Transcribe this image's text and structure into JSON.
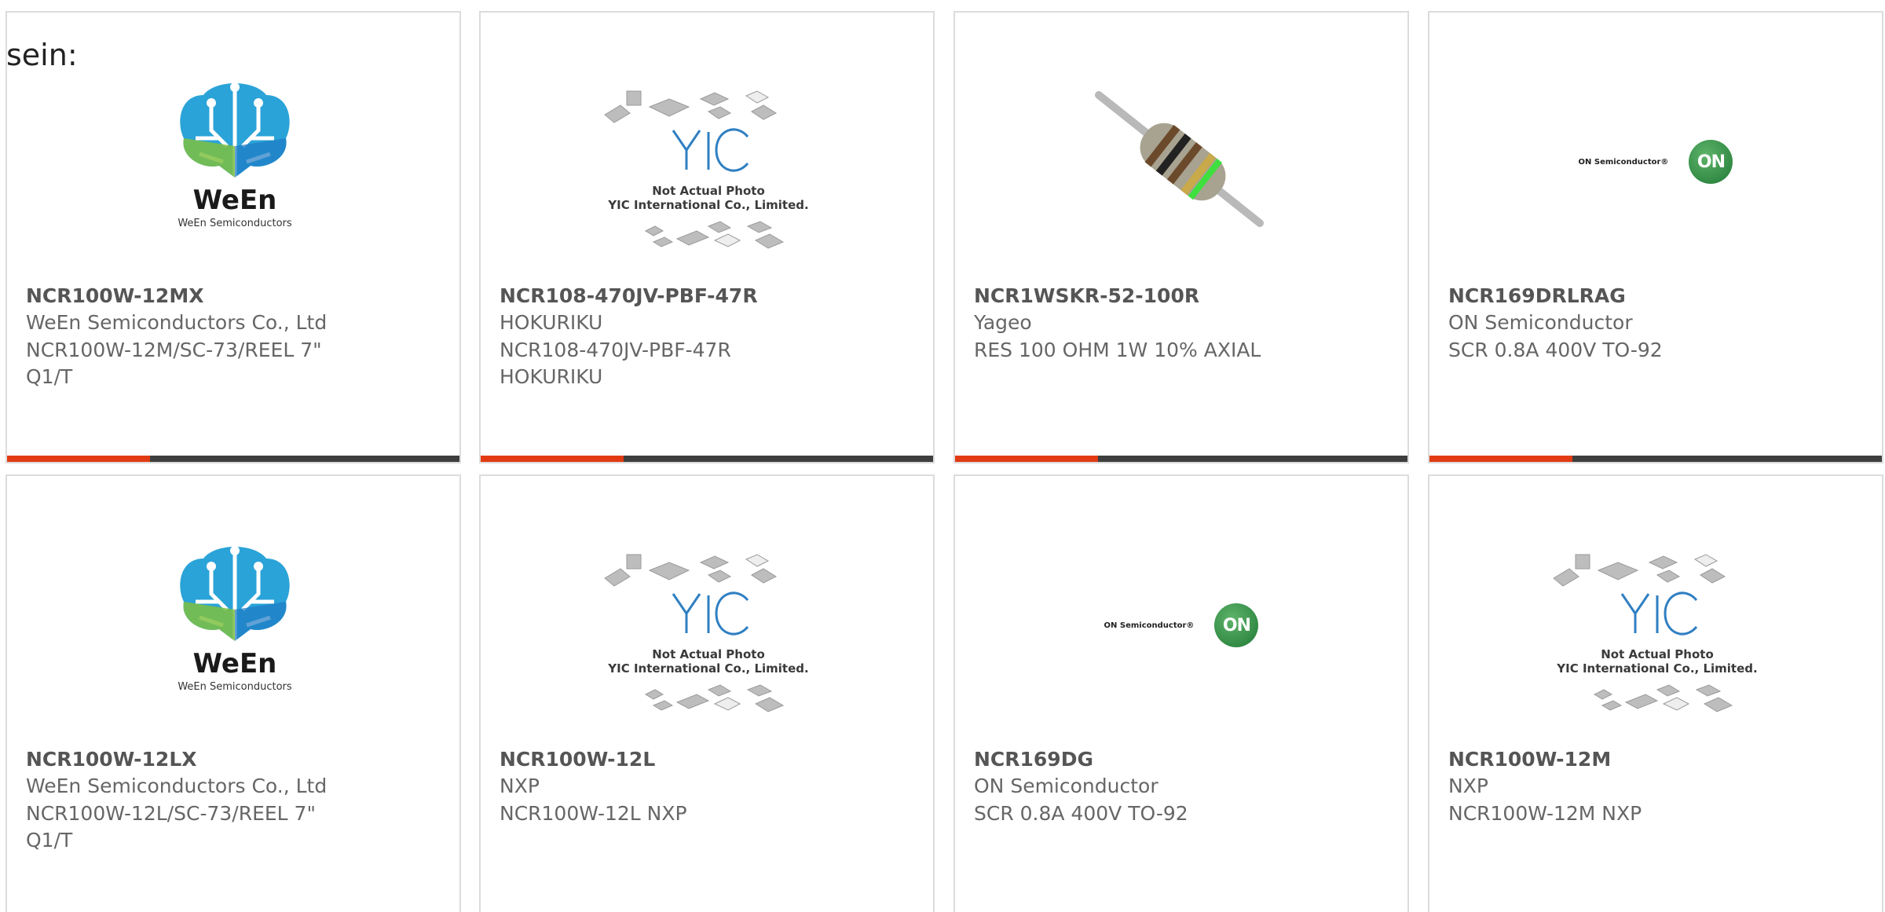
{
  "intro_text": "sein:",
  "colors": {
    "accent": "#e23b13",
    "bar": "#3e3e3e",
    "card_border": "#dcdcdc"
  },
  "image_texts": {
    "ween_brand": "WeEn",
    "ween_sub": "WeEn Semiconductors",
    "yic_line1": "Not Actual Photo",
    "yic_line2": "YIC International Co., Limited.",
    "on_brand": "ON Semiconductor®",
    "on_badge": "ON"
  },
  "products": [
    {
      "part_number": "NCR100W-12MX",
      "manufacturer": "WeEn Semiconductors Co., Ltd",
      "description": "NCR100W-12M/SC-73/REEL 7\"",
      "description_extra": "Q1/T",
      "image": "ween-logo"
    },
    {
      "part_number": "NCR108-470JV-PBF-47R",
      "manufacturer": "HOKURIKU",
      "description": "NCR108-470JV-PBF-47R",
      "description_extra": "HOKURIKU",
      "image": "yic-placeholder"
    },
    {
      "part_number": "NCR1WSKR-52-100R",
      "manufacturer": "Yageo",
      "description": "RES 100 OHM 1W 10% AXIAL",
      "description_extra": "",
      "image": "resistor-photo"
    },
    {
      "part_number": "NCR169DRLRAG",
      "manufacturer": "ON Semiconductor",
      "description": "SCR 0.8A 400V TO-92",
      "description_extra": "",
      "image": "on-semi-logo"
    },
    {
      "part_number": "NCR100W-12LX",
      "manufacturer": "WeEn Semiconductors Co., Ltd",
      "description": "NCR100W-12L/SC-73/REEL 7\"",
      "description_extra": "Q1/T",
      "image": "ween-logo"
    },
    {
      "part_number": "NCR100W-12L",
      "manufacturer": "NXP",
      "description": "NCR100W-12L NXP",
      "description_extra": "",
      "image": "yic-placeholder"
    },
    {
      "part_number": "NCR169DG",
      "manufacturer": "ON Semiconductor",
      "description": "SCR 0.8A 400V TO-92",
      "description_extra": "",
      "image": "on-semi-logo"
    },
    {
      "part_number": "NCR100W-12M",
      "manufacturer": "NXP",
      "description": "NCR100W-12M NXP",
      "description_extra": "",
      "image": "yic-placeholder"
    }
  ]
}
